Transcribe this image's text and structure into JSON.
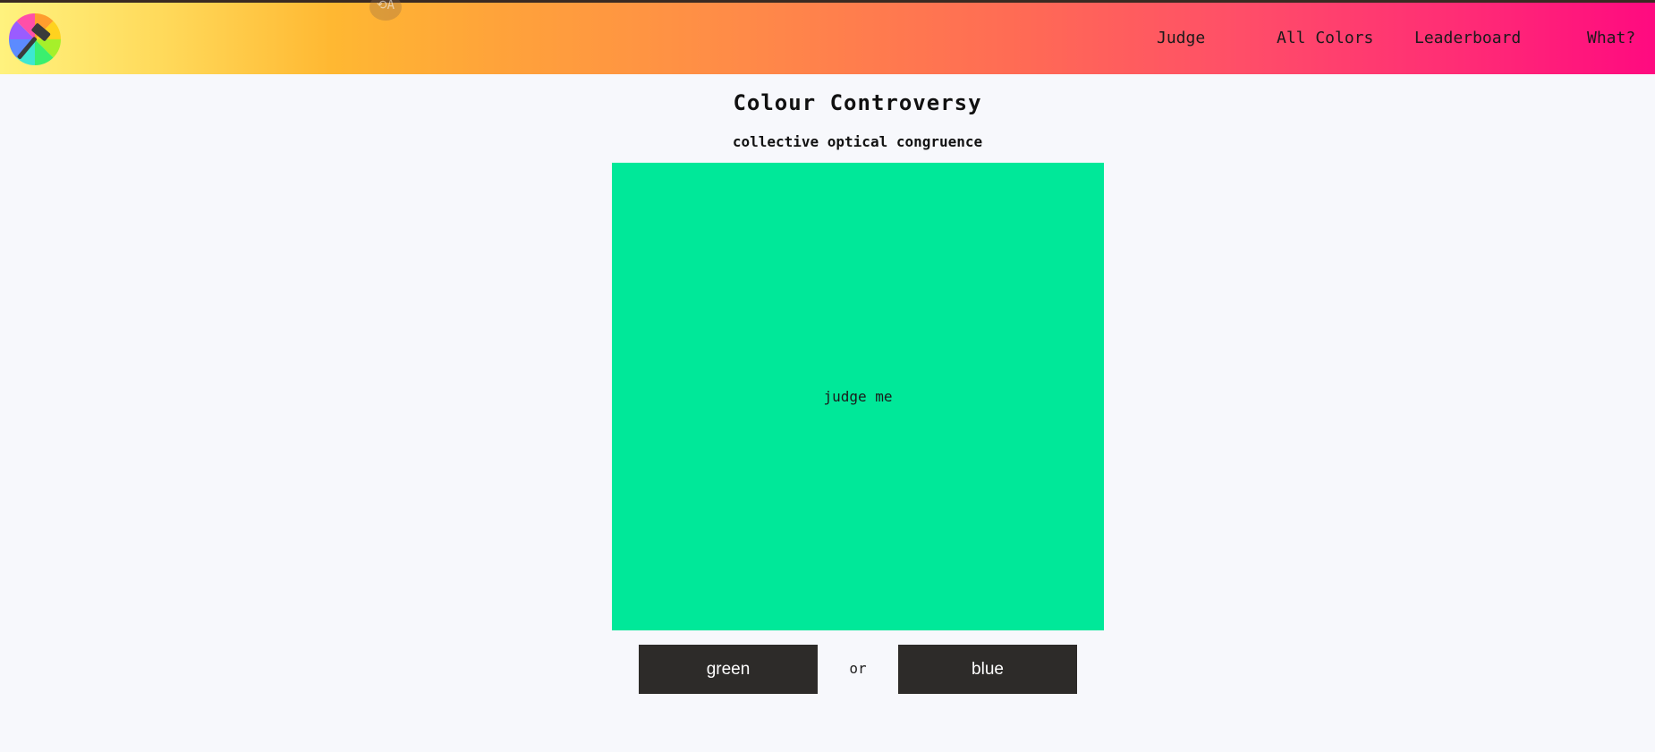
{
  "header": {
    "logo_icon": "gavel-on-color-wheel-icon",
    "nav": {
      "judge": "Judge",
      "all_colors": "All Colors",
      "leaderboard": "Leaderboard",
      "what": "What?"
    },
    "gradient_colors": [
      "#fff27e",
      "#ffb832",
      "#ff8a48",
      "#ff4e68",
      "#ff0a80"
    ]
  },
  "main": {
    "title": "Colour Controversy",
    "subtitle": "collective optical congruence",
    "swatch": {
      "color": "#00e899",
      "label": "judge me"
    },
    "choices": {
      "green_label": "green",
      "or_label": "or",
      "blue_label": "blue"
    }
  }
}
